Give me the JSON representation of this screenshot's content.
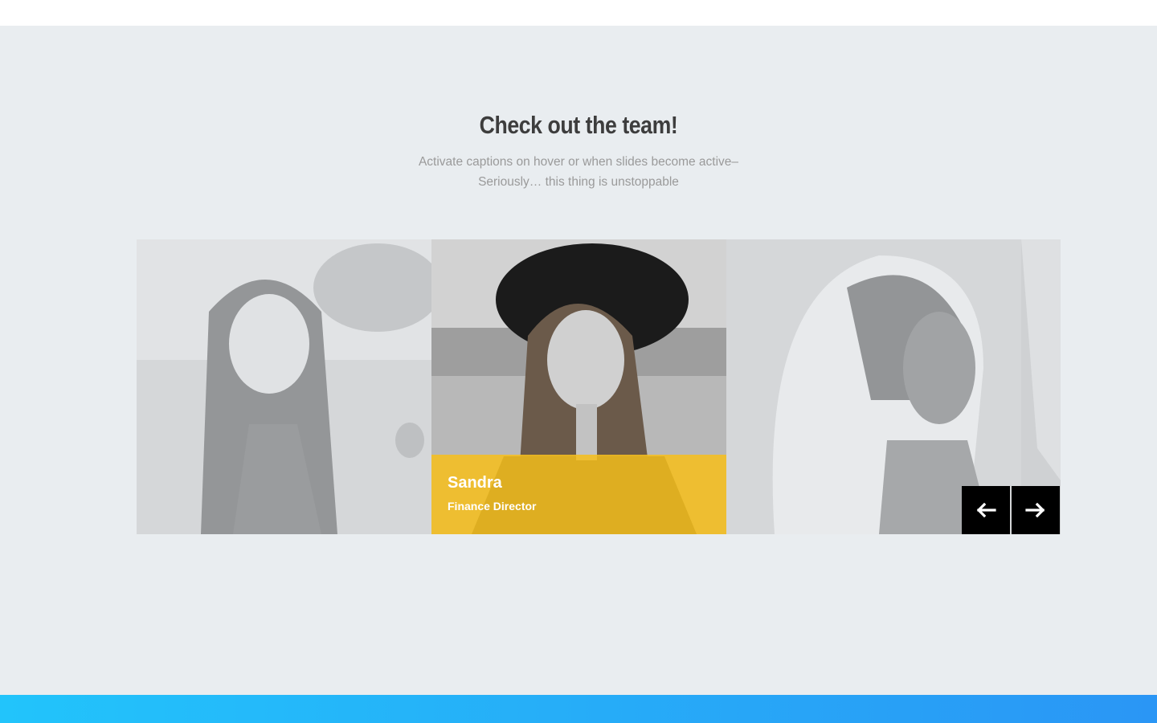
{
  "section": {
    "title": "Check out the team!",
    "subtitle": "Activate captions on hover or when slides become active– Seriously… this thing is unstoppable"
  },
  "slides": [
    {
      "state": "inactive",
      "image": "photo-woman-long-hair"
    },
    {
      "state": "active",
      "image": "photo-woman-hat",
      "name": "Sandra",
      "role": "Finance Director"
    },
    {
      "state": "inactive",
      "image": "photo-woman-headscarf"
    },
    {
      "state": "inactive",
      "image": "photo-partial"
    }
  ],
  "controls": {
    "prev_icon": "arrow-left-icon",
    "next_icon": "arrow-right-icon"
  },
  "colors": {
    "background": "#e9edf0",
    "caption": "#f5be1e",
    "nav_button": "#000000",
    "footer_gradient_start": "#22c4fb",
    "footer_gradient_end": "#2a96f5"
  }
}
